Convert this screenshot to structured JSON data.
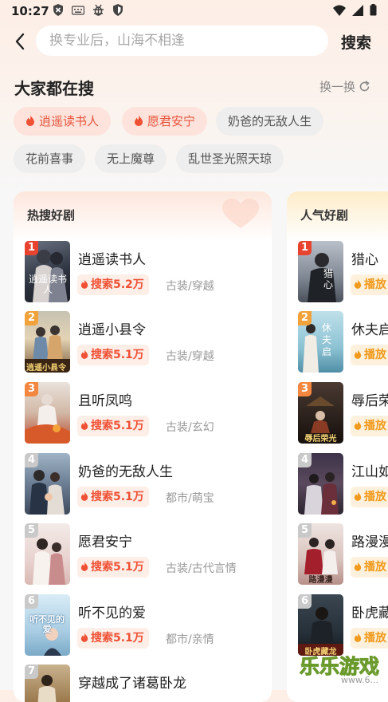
{
  "status_bar": {
    "time": "10:27"
  },
  "search": {
    "placeholder": "换专业后，山海不相逢",
    "button_label": "搜索"
  },
  "trending": {
    "title": "大家都在搜",
    "refresh_label": "换一换",
    "tags": [
      {
        "label": "逍遥读书人",
        "hot": true
      },
      {
        "label": "愿君安宁",
        "hot": true
      },
      {
        "label": "奶爸的无敌人生",
        "hot": false
      },
      {
        "label": "花前喜事",
        "hot": false
      },
      {
        "label": "无上魔尊",
        "hot": false
      },
      {
        "label": "乱世圣光照天琼",
        "hot": false
      }
    ]
  },
  "hot_drama": {
    "title": "热搜好剧",
    "items": [
      {
        "rank": "1",
        "title": "逍遥读书人",
        "search_count": "搜索5.2万",
        "genre": "古装/穿越",
        "cover_text": "逍遥读书人"
      },
      {
        "rank": "2",
        "title": "逍遥小县令",
        "search_count": "搜索5.1万",
        "genre": "古装/穿越",
        "cover_text": "逍遥小县令"
      },
      {
        "rank": "3",
        "title": "且听凤鸣",
        "search_count": "搜索5.1万",
        "genre": "古装/玄幻",
        "cover_text": ""
      },
      {
        "rank": "4",
        "title": "奶爸的无敌人生",
        "search_count": "搜索5.1万",
        "genre": "都市/萌宝",
        "cover_text": ""
      },
      {
        "rank": "5",
        "title": "愿君安宁",
        "search_count": "搜索5.1万",
        "genre": "古装/古代言情",
        "cover_text": ""
      },
      {
        "rank": "6",
        "title": "听不见的爱",
        "search_count": "搜索5.1万",
        "genre": "都市/亲情",
        "cover_text": "听不见的爱"
      },
      {
        "rank": "7",
        "title": "穿越成了诸葛卧龙",
        "search_count": "",
        "genre": "",
        "cover_text": ""
      }
    ]
  },
  "popular_drama": {
    "title": "人气好剧",
    "items": [
      {
        "rank": "1",
        "title": "猎心",
        "badge": "播放",
        "cover_text": "猎心"
      },
      {
        "rank": "2",
        "title": "休夫启",
        "badge": "播放",
        "cover_text": "休夫启"
      },
      {
        "rank": "3",
        "title": "辱后荣",
        "badge": "播放",
        "cover_text": "辱后荣光"
      },
      {
        "rank": "4",
        "title": "江山如",
        "badge": "播放",
        "cover_text": ""
      },
      {
        "rank": "5",
        "title": "路漫漫",
        "badge": "播放",
        "cover_text": "路漫漫"
      },
      {
        "rank": "6",
        "title": "卧虎藏",
        "badge": "播放",
        "cover_text": "卧虎藏龙"
      }
    ]
  },
  "watermark": {
    "text": "乐乐游戏",
    "url": "www.6..."
  },
  "colors": {
    "accent_red": "#f05033",
    "accent_orange": "#f19a1b",
    "rank1": "#e8432f",
    "rank2": "#f2a23a",
    "rank3": "#f4873f",
    "rank_other": "#c9c9c9"
  }
}
